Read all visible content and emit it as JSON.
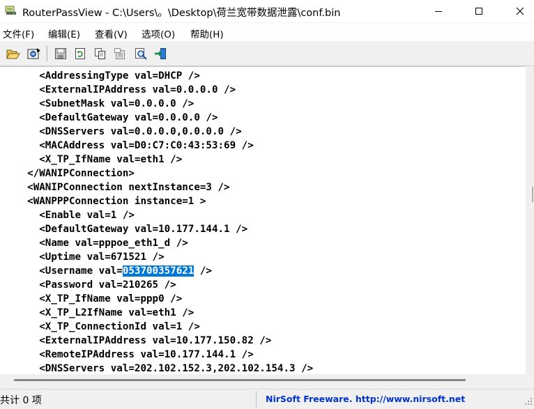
{
  "window": {
    "title": "RouterPassView   -   C:\\Users\\。\\Desktop\\荷兰宽带数据泄露\\conf.bin",
    "controls": [
      "minimize-icon",
      "maximize-icon",
      "close-icon"
    ]
  },
  "menu": [
    "文件(F)",
    "编辑(E)",
    "查看(V)",
    "选项(O)",
    "帮助(H)"
  ],
  "toolbar": [
    "open-folder-icon",
    "open-browser-icon",
    "save-icon",
    "refresh-icon",
    "copy-icon",
    "properties-icon",
    "find-icon",
    "exit-icon"
  ],
  "content": {
    "lines": [
      "      <AddressingType val=DHCP />",
      "      <ExternalIPAddress val=0.0.0.0 />",
      "      <SubnetMask val=0.0.0.0 />",
      "      <DefaultGateway val=0.0.0.0 />",
      "      <DNSServers val=0.0.0.0,0.0.0.0 />",
      "      <MACAddress val=D0:C7:C0:43:53:69 />",
      "      <X_TP_IfName val=eth1 />",
      "    </WANIPConnection>",
      "    <WANIPConnection nextInstance=3 />",
      "    <WANPPPConnection instance=1 >",
      "      <Enable val=1 />",
      "      <DefaultGateway val=10.177.144.1 />",
      "      <Name val=pppoe_eth1_d />",
      "      <Uptime val=671521 />",
      "      <Username val=",
      "      <Password val=210265 />",
      "      <X_TP_IfName val=ppp0 />",
      "      <X_TP_L2IfName val=eth1 />",
      "      <X_TP_ConnectionId val=1 />",
      "      <ExternalIPAddress val=10.177.150.82 />",
      "      <RemoteIPAddress val=10.177.144.1 />",
      "      <DNSServers val=202.102.152.3,202.102.154.3 />"
    ],
    "selected_text": "053700357621",
    "selected_suffix": " />",
    "selected_line_index": 14,
    "selection_color": "#0078d7"
  },
  "status": {
    "count": "共计 0 项",
    "link": "NirSoft Freeware.  http://www.nirsoft.net"
  }
}
